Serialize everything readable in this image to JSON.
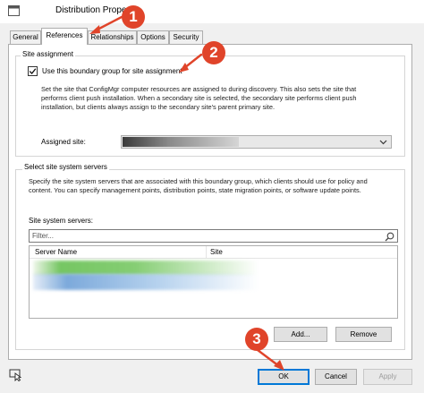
{
  "window": {
    "title": "Distribution Proper"
  },
  "tabs": [
    {
      "label": "General"
    },
    {
      "label": "References"
    },
    {
      "label": "Relationships"
    },
    {
      "label": "Options"
    },
    {
      "label": "Security"
    }
  ],
  "site_assignment": {
    "group_title": "Site assignment",
    "checkbox_label": "Use this boundary group for site assignment",
    "checked": true,
    "description_lines": [
      "Set the site that ConfigMgr computer resources are assigned to during discovery. This also sets the site that",
      "performs client push installation. When a secondary site is selected, the secondary site performs client push",
      "installation, but clients always assign to the secondary site's parent primary site."
    ],
    "assigned_site_label": "Assigned site:"
  },
  "site_system_servers": {
    "group_title": "Select site system servers",
    "description_lines": [
      "Specify the site system servers that are associated with this boundary group, which clients should use for policy and",
      "content. You can specify management points, distribution points, state migration points, or software update points."
    ],
    "list_label": "Site system servers:",
    "filter_placeholder": "Filter...",
    "columns": [
      "Server Name",
      "Site"
    ],
    "add_button": "Add...",
    "remove_button": "Remove"
  },
  "footer": {
    "ok_button": "OK",
    "cancel_button": "Cancel",
    "apply_button": "Apply"
  },
  "annotations": [
    {
      "number": "1"
    },
    {
      "number": "2"
    },
    {
      "number": "3"
    }
  ],
  "colors": {
    "accent": "#0078d7",
    "annotation": "#e0442a"
  }
}
